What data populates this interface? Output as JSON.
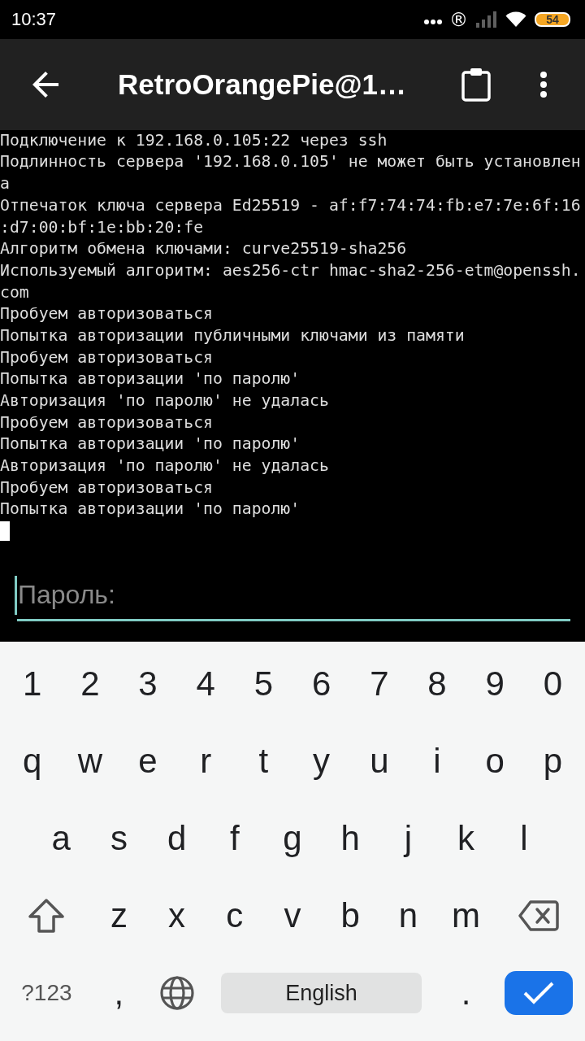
{
  "status_bar": {
    "time": "10:37",
    "notification": "®",
    "battery": "54"
  },
  "app_bar": {
    "title": "RetroOrangePie@1…"
  },
  "terminal": {
    "lines": [
      "Подключение к 192.168.0.105:22 через ssh",
      "Подлинность сервера '192.168.0.105' не может быть установлена",
      "Отпечаток ключа сервера Ed25519 - af:f7:74:74:fb:e7:7e:6f:16:d7:00:bf:1e:bb:20:fe",
      "Алгоритм обмена ключами: curve25519-sha256",
      "Используемый алгоритм: aes256-ctr hmac-sha2-256-etm@openssh.com",
      "Пробуем авторизоваться",
      "Попытка авторизации публичными ключами из памяти",
      "Пробуем авторизоваться",
      "Попытка авторизации 'по паролю'",
      "Авторизация 'по паролю' не удалась",
      "Пробуем авторизоваться",
      "Попытка авторизации 'по паролю'",
      "Авторизация 'по паролю' не удалась",
      "Пробуем авторизоваться",
      "Попытка авторизации 'по паролю'"
    ]
  },
  "password_field": {
    "placeholder": "Пароль:"
  },
  "keyboard": {
    "rows": [
      {
        "keys": [
          {
            "kind": "char",
            "label": "1"
          },
          {
            "kind": "char",
            "label": "2"
          },
          {
            "kind": "char",
            "label": "3"
          },
          {
            "kind": "char",
            "label": "4"
          },
          {
            "kind": "char",
            "label": "5"
          },
          {
            "kind": "char",
            "label": "6"
          },
          {
            "kind": "char",
            "label": "7"
          },
          {
            "kind": "char",
            "label": "8"
          },
          {
            "kind": "char",
            "label": "9"
          },
          {
            "kind": "char",
            "label": "0"
          }
        ]
      },
      {
        "keys": [
          {
            "kind": "char",
            "label": "q"
          },
          {
            "kind": "char",
            "label": "w"
          },
          {
            "kind": "char",
            "label": "e"
          },
          {
            "kind": "char",
            "label": "r"
          },
          {
            "kind": "char",
            "label": "t"
          },
          {
            "kind": "char",
            "label": "y"
          },
          {
            "kind": "char",
            "label": "u"
          },
          {
            "kind": "char",
            "label": "i"
          },
          {
            "kind": "char",
            "label": "o"
          },
          {
            "kind": "char",
            "label": "p"
          }
        ]
      },
      {
        "keys": [
          {
            "kind": "char",
            "label": "a"
          },
          {
            "kind": "char",
            "label": "s"
          },
          {
            "kind": "char",
            "label": "d"
          },
          {
            "kind": "char",
            "label": "f"
          },
          {
            "kind": "char",
            "label": "g"
          },
          {
            "kind": "char",
            "label": "h"
          },
          {
            "kind": "char",
            "label": "j"
          },
          {
            "kind": "char",
            "label": "k"
          },
          {
            "kind": "char",
            "label": "l"
          }
        ]
      },
      {
        "keys": [
          {
            "kind": "shift"
          },
          {
            "kind": "char",
            "label": "z"
          },
          {
            "kind": "char",
            "label": "x"
          },
          {
            "kind": "char",
            "label": "c"
          },
          {
            "kind": "char",
            "label": "v"
          },
          {
            "kind": "char",
            "label": "b"
          },
          {
            "kind": "char",
            "label": "n"
          },
          {
            "kind": "char",
            "label": "m"
          },
          {
            "kind": "backspace"
          }
        ]
      },
      {
        "keys": [
          {
            "kind": "symbols",
            "label": "?123"
          },
          {
            "kind": "char",
            "label": ","
          },
          {
            "kind": "globe"
          },
          {
            "kind": "space",
            "label": "English"
          },
          {
            "kind": "char",
            "label": "."
          },
          {
            "kind": "enter"
          }
        ]
      }
    ]
  }
}
